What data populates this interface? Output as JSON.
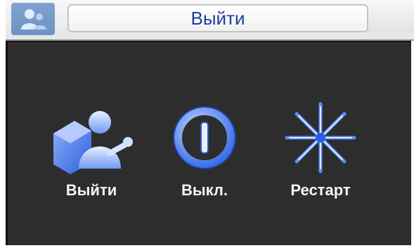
{
  "window": {
    "title": "Выйти"
  },
  "options": [
    {
      "label": "Выйти",
      "icon": "logout-user-icon"
    },
    {
      "label": "Выкл.",
      "icon": "power-icon"
    },
    {
      "label": "Рестарт",
      "icon": "restart-star-icon"
    }
  ],
  "colors": {
    "background": "#2d2d2d",
    "title_text": "#1c3f9a",
    "label_text": "#f5f5f5",
    "icon_blue": "#4a7de8"
  }
}
